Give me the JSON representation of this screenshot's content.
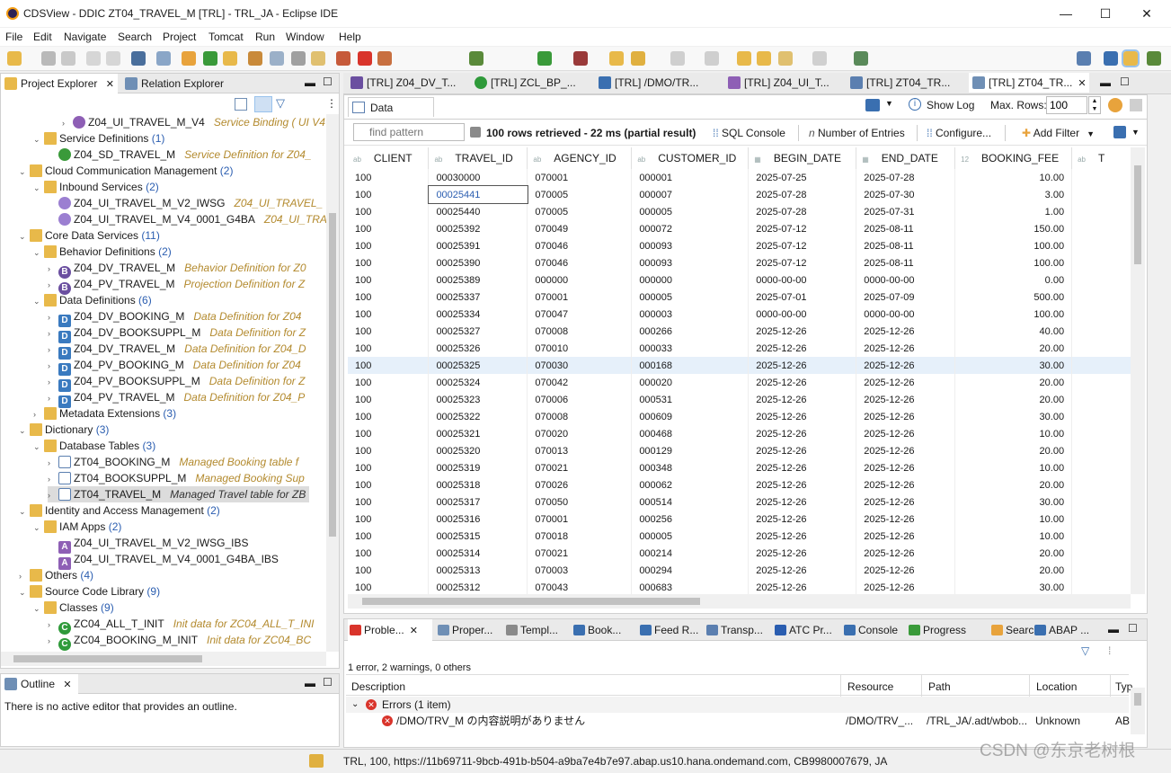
{
  "window": {
    "title": "CDSView - DDIC ZT04_TRAVEL_M [TRL] - TRL_JA - Eclipse IDE"
  },
  "menu": [
    "File",
    "Edit",
    "Navigate",
    "Search",
    "Project",
    "Tomcat",
    "Run",
    "Window",
    "Help"
  ],
  "left_tabs": {
    "project_explorer": "Project Explorer",
    "relation_explorer": "Relation Explorer"
  },
  "tree": [
    {
      "indent": 6,
      "twist": "›",
      "icon": "svc",
      "iconColor": "#8e5fb5",
      "label": "Z04_UI_TRAVEL_M_V4",
      "desc": "Service Binding ( UI V4"
    },
    {
      "indent": 4,
      "twist": "⌄",
      "icon": "fold",
      "label": "Service Definitions",
      "count": "(1)"
    },
    {
      "indent": 5,
      "twist": "",
      "icon": "svc",
      "iconColor": "#3a9a3a",
      "label": "Z04_SD_TRAVEL_M",
      "desc": "Service Definition for Z04_"
    },
    {
      "indent": 3,
      "twist": "⌄",
      "icon": "fold",
      "label": "Cloud Communication Management",
      "count": "(2)"
    },
    {
      "indent": 4,
      "twist": "⌄",
      "icon": "fold",
      "label": "Inbound Services",
      "count": "(2)"
    },
    {
      "indent": 5,
      "twist": "",
      "icon": "svc",
      "iconColor": "#9b7fd1",
      "label": "Z04_UI_TRAVEL_M_V2_IWSG",
      "desc": "Z04_UI_TRAVEL_"
    },
    {
      "indent": 5,
      "twist": "",
      "icon": "svc",
      "iconColor": "#9b7fd1",
      "label": "Z04_UI_TRAVEL_M_V4_0001_G4BA",
      "desc": "Z04_UI_TRA"
    },
    {
      "indent": 3,
      "twist": "⌄",
      "icon": "fold",
      "label": "Core Data Services",
      "count": "(11)"
    },
    {
      "indent": 4,
      "twist": "⌄",
      "icon": "fold",
      "label": "Behavior Definitions",
      "count": "(2)"
    },
    {
      "indent": 5,
      "twist": "›",
      "icon": "B",
      "iconColor": "#6b4fa0",
      "label": "Z04_DV_TRAVEL_M",
      "desc": "Behavior Definition for Z0"
    },
    {
      "indent": 5,
      "twist": "›",
      "icon": "B",
      "iconColor": "#6b4fa0",
      "label": "Z04_PV_TRAVEL_M",
      "desc": "Projection Definition for Z"
    },
    {
      "indent": 4,
      "twist": "⌄",
      "icon": "fold",
      "label": "Data Definitions",
      "count": "(6)"
    },
    {
      "indent": 5,
      "twist": "›",
      "icon": "D",
      "iconColor": "#3a7abf",
      "label": "Z04_DV_BOOKING_M",
      "desc": "Data Definition for Z04"
    },
    {
      "indent": 5,
      "twist": "›",
      "icon": "D",
      "iconColor": "#3a7abf",
      "label": "Z04_DV_BOOKSUPPL_M",
      "desc": "Data Definition for Z"
    },
    {
      "indent": 5,
      "twist": "›",
      "icon": "D",
      "iconColor": "#3a7abf",
      "label": "Z04_DV_TRAVEL_M",
      "desc": "Data Definition for Z04_D"
    },
    {
      "indent": 5,
      "twist": "›",
      "icon": "D",
      "iconColor": "#3a7abf",
      "label": "Z04_PV_BOOKING_M",
      "desc": "Data Definition for Z04"
    },
    {
      "indent": 5,
      "twist": "›",
      "icon": "D",
      "iconColor": "#3a7abf",
      "label": "Z04_PV_BOOKSUPPL_M",
      "desc": "Data Definition for Z"
    },
    {
      "indent": 5,
      "twist": "›",
      "icon": "D",
      "iconColor": "#3a7abf",
      "label": "Z04_PV_TRAVEL_M",
      "desc": "Data Definition for Z04_P"
    },
    {
      "indent": 4,
      "twist": "›",
      "icon": "fold",
      "label": "Metadata Extensions",
      "count": "(3)"
    },
    {
      "indent": 3,
      "twist": "⌄",
      "icon": "fold",
      "label": "Dictionary",
      "count": "(3)"
    },
    {
      "indent": 4,
      "twist": "⌄",
      "icon": "fold",
      "label": "Database Tables",
      "count": "(3)"
    },
    {
      "indent": 5,
      "twist": "›",
      "icon": "tbl",
      "iconColor": "#5b7fb0",
      "label": "ZT04_BOOKING_M",
      "desc": "Managed Booking table f"
    },
    {
      "indent": 5,
      "twist": "›",
      "icon": "tbl",
      "iconColor": "#5b7fb0",
      "label": "ZT04_BOOKSUPPL_M",
      "desc": "Managed Booking Sup"
    },
    {
      "indent": 5,
      "twist": "›",
      "icon": "tbl",
      "iconColor": "#5b7fb0",
      "label": "ZT04_TRAVEL_M",
      "desc": "Managed Travel table for ZB",
      "selected": true
    },
    {
      "indent": 3,
      "twist": "⌄",
      "icon": "fold",
      "label": "Identity and Access Management",
      "count": "(2)"
    },
    {
      "indent": 4,
      "twist": "⌄",
      "icon": "fold",
      "label": "IAM Apps",
      "count": "(2)"
    },
    {
      "indent": 5,
      "twist": "",
      "icon": "A",
      "iconColor": "#8e5fb5",
      "label": "Z04_UI_TRAVEL_M_V2_IWSG_IBS"
    },
    {
      "indent": 5,
      "twist": "",
      "icon": "A",
      "iconColor": "#8e5fb5",
      "label": "Z04_UI_TRAVEL_M_V4_0001_G4BA_IBS"
    },
    {
      "indent": 3,
      "twist": "›",
      "icon": "fold",
      "label": "Others",
      "count": "(4)"
    },
    {
      "indent": 3,
      "twist": "⌄",
      "icon": "fold",
      "label": "Source Code Library",
      "count": "(9)"
    },
    {
      "indent": 4,
      "twist": "⌄",
      "icon": "fold",
      "label": "Classes",
      "count": "(9)"
    },
    {
      "indent": 5,
      "twist": "›",
      "icon": "C",
      "iconColor": "#2f9a3a",
      "label": "ZC04_ALL_T_INIT",
      "desc": "Init data for ZC04_ALL_T_INI"
    },
    {
      "indent": 5,
      "twist": "›",
      "icon": "C",
      "iconColor": "#2f9a3a",
      "label": "ZC04_BOOKING_M_INIT",
      "desc": "Init data for ZC04_BC"
    }
  ],
  "outline": {
    "tab": "Outline",
    "message": "There is no active editor that provides an outline."
  },
  "editor_tabs": [
    "[TRL] Z04_DV_T...",
    "[TRL] ZCL_BP_...",
    "[TRL] /DMO/TR...",
    "[TRL] Z04_UI_T...",
    "[TRL] ZT04_TR...",
    "[TRL] ZT04_TR..."
  ],
  "data_preview": {
    "tab": "Data Preview",
    "show_log": "Show Log",
    "max_rows_label": "Max. Rows:",
    "max_rows": "100",
    "filter_placeholder": "find pattern",
    "status": "100 rows retrieved - 22 ms (partial result)",
    "sql_console": "SQL Console",
    "number_of_entries": "Number of Entries",
    "configure": "Configure...",
    "add_filter": "Add Filter",
    "columns": [
      "CLIENT",
      "TRAVEL_ID",
      "AGENCY_ID",
      "CUSTOMER_ID",
      "BEGIN_DATE",
      "END_DATE",
      "BOOKING_FEE",
      "T"
    ],
    "rows": [
      [
        "100",
        "00030000",
        "070001",
        "000001",
        "2025-07-25",
        "2025-07-28",
        "10.00"
      ],
      [
        "100",
        "00025441",
        "070005",
        "000007",
        "2025-07-28",
        "2025-07-30",
        "3.00"
      ],
      [
        "100",
        "00025440",
        "070005",
        "000005",
        "2025-07-28",
        "2025-07-31",
        "1.00"
      ],
      [
        "100",
        "00025392",
        "070049",
        "000072",
        "2025-07-12",
        "2025-08-11",
        "150.00"
      ],
      [
        "100",
        "00025391",
        "070046",
        "000093",
        "2025-07-12",
        "2025-08-11",
        "100.00"
      ],
      [
        "100",
        "00025390",
        "070046",
        "000093",
        "2025-07-12",
        "2025-08-11",
        "100.00"
      ],
      [
        "100",
        "00025389",
        "000000",
        "000000",
        "0000-00-00",
        "0000-00-00",
        "0.00"
      ],
      [
        "100",
        "00025337",
        "070001",
        "000005",
        "2025-07-01",
        "2025-07-09",
        "500.00"
      ],
      [
        "100",
        "00025334",
        "070047",
        "000003",
        "0000-00-00",
        "0000-00-00",
        "100.00"
      ],
      [
        "100",
        "00025327",
        "070008",
        "000266",
        "2025-12-26",
        "2025-12-26",
        "40.00"
      ],
      [
        "100",
        "00025326",
        "070010",
        "000033",
        "2025-12-26",
        "2025-12-26",
        "20.00"
      ],
      [
        "100",
        "00025325",
        "070030",
        "000168",
        "2025-12-26",
        "2025-12-26",
        "30.00"
      ],
      [
        "100",
        "00025324",
        "070042",
        "000020",
        "2025-12-26",
        "2025-12-26",
        "20.00"
      ],
      [
        "100",
        "00025323",
        "070006",
        "000531",
        "2025-12-26",
        "2025-12-26",
        "20.00"
      ],
      [
        "100",
        "00025322",
        "070008",
        "000609",
        "2025-12-26",
        "2025-12-26",
        "30.00"
      ],
      [
        "100",
        "00025321",
        "070020",
        "000468",
        "2025-12-26",
        "2025-12-26",
        "10.00"
      ],
      [
        "100",
        "00025320",
        "070013",
        "000129",
        "2025-12-26",
        "2025-12-26",
        "20.00"
      ],
      [
        "100",
        "00025319",
        "070021",
        "000348",
        "2025-12-26",
        "2025-12-26",
        "10.00"
      ],
      [
        "100",
        "00025318",
        "070026",
        "000062",
        "2025-12-26",
        "2025-12-26",
        "20.00"
      ],
      [
        "100",
        "00025317",
        "070050",
        "000514",
        "2025-12-26",
        "2025-12-26",
        "30.00"
      ],
      [
        "100",
        "00025316",
        "070001",
        "000256",
        "2025-12-26",
        "2025-12-26",
        "10.00"
      ],
      [
        "100",
        "00025315",
        "070018",
        "000005",
        "2025-12-26",
        "2025-12-26",
        "10.00"
      ],
      [
        "100",
        "00025314",
        "070021",
        "000214",
        "2025-12-26",
        "2025-12-26",
        "20.00"
      ],
      [
        "100",
        "00025313",
        "070003",
        "000294",
        "2025-12-26",
        "2025-12-26",
        "20.00"
      ],
      [
        "100",
        "00025312",
        "070043",
        "000683",
        "2025-12-26",
        "2025-12-26",
        "30.00"
      ]
    ]
  },
  "bottom_tabs": [
    "Proble...",
    "Proper...",
    "Templ...",
    "Book...",
    "Feed R...",
    "Transp...",
    "ATC Pr...",
    "Console",
    "Progress",
    "Search",
    "ABAP ..."
  ],
  "problems": {
    "summary": "1 error, 2 warnings, 0 others",
    "columns": [
      "Description",
      "Resource",
      "Path",
      "Location",
      "Typ"
    ],
    "group": "Errors (1 item)",
    "item": {
      "description": "/DMO/TRV_M の内容説明がありません",
      "resource": "/DMO/TRV_...",
      "path": "/TRL_JA/.adt/wbob...",
      "location": "Unknown",
      "type": "AB"
    }
  },
  "statusbar": "TRL, 100, https://11b69711-9bcb-491b-b504-a9ba7e4b7e97.abap.us10.hana.ondemand.com, CB9980007679, JA",
  "watermark": "CSDN @东京老树根",
  "colors": {
    "accent": "#2a5db0",
    "selection": "#e6f0fa",
    "error": "#d9342b"
  }
}
